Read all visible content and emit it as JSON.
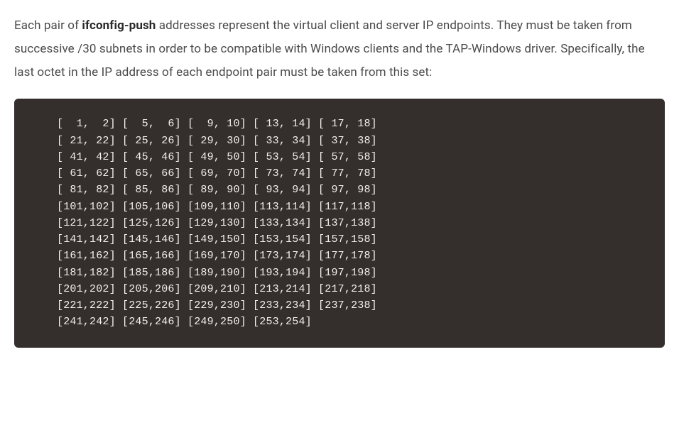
{
  "paragraph": {
    "pre": "Each pair of ",
    "bold": "ifconfig-push",
    "post": " addresses represent the virtual client and server IP endpoints. They must be taken from successive /30 subnets in order to be compatible with Windows clients and the TAP-Windows driver. Specifically, the last octet in the IP address of each endpoint pair must be taken from this set:"
  },
  "code": "[  1,  2] [  5,  6] [  9, 10] [ 13, 14] [ 17, 18]\n[ 21, 22] [ 25, 26] [ 29, 30] [ 33, 34] [ 37, 38]\n[ 41, 42] [ 45, 46] [ 49, 50] [ 53, 54] [ 57, 58]\n[ 61, 62] [ 65, 66] [ 69, 70] [ 73, 74] [ 77, 78]\n[ 81, 82] [ 85, 86] [ 89, 90] [ 93, 94] [ 97, 98]\n[101,102] [105,106] [109,110] [113,114] [117,118]\n[121,122] [125,126] [129,130] [133,134] [137,138]\n[141,142] [145,146] [149,150] [153,154] [157,158]\n[161,162] [165,166] [169,170] [173,174] [177,178]\n[181,182] [185,186] [189,190] [193,194] [197,198]\n[201,202] [205,206] [209,210] [213,214] [217,218]\n[221,222] [225,226] [229,230] [233,234] [237,238]\n[241,242] [245,246] [249,250] [253,254]"
}
